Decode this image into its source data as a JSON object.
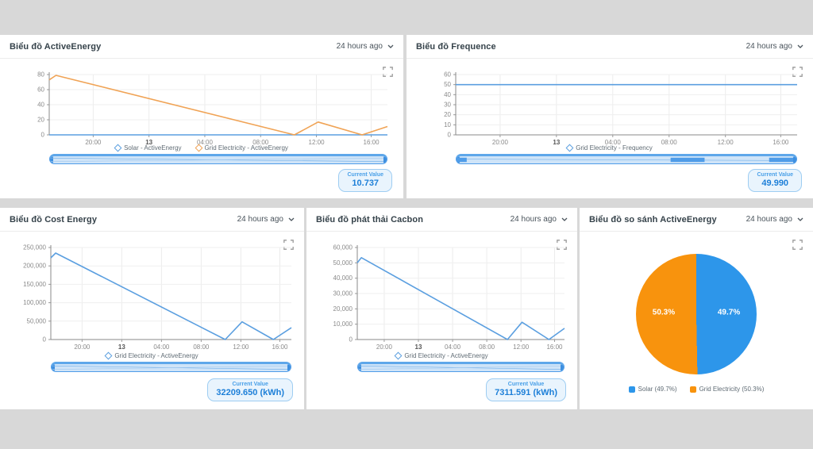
{
  "page": {
    "background": "#d8d8d8"
  },
  "icons": {
    "fullscreen": "fullscreen-icon",
    "chevron": "chevron-down-icon"
  },
  "colors": {
    "pie_blue": "#2d96ea",
    "pie_orange": "#f8930d",
    "line_blue": "#5b9fe0",
    "line_orange": "#f0a355",
    "value_text": "#1d7fd8"
  },
  "panels": [
    {
      "title": "Biểu đồ ActiveEnergy",
      "time_range": "24 hours ago",
      "current_value_label": "Current Value",
      "current_value": "10.737"
    },
    {
      "title": "Biểu đồ Frequence",
      "time_range": "24 hours ago",
      "current_value_label": "Current Value",
      "current_value": "49.990"
    },
    {
      "title": "Biểu đồ Cost Energy",
      "time_range": "24 hours ago",
      "current_value_label": "Current Value",
      "current_value": "32209.650 (kWh)"
    },
    {
      "title": "Biểu đồ phát thải Cacbon",
      "time_range": "24 hours ago",
      "current_value_label": "Current Value",
      "current_value": "7311.591 (kWh)"
    },
    {
      "title": "Biểu đồ so sánh ActiveEnergy",
      "time_range": "24 hours ago"
    }
  ],
  "chart_data": [
    {
      "type": "line",
      "title": "Biểu đồ ActiveEnergy",
      "xlabel": "",
      "ylabel": "",
      "ylim": [
        0,
        80
      ],
      "y_ticks": [
        "0",
        "20",
        "40",
        "60",
        "80"
      ],
      "grid": true,
      "legend_position": "bottom",
      "x_ticks": [
        {
          "label": "20:00",
          "x": 0.13
        },
        {
          "label": "13",
          "x": 0.295,
          "bold": true
        },
        {
          "label": "04:00",
          "x": 0.46
        },
        {
          "label": "08:00",
          "x": 0.625
        },
        {
          "label": "12:00",
          "x": 0.79
        },
        {
          "label": "16:00",
          "x": 0.952
        }
      ],
      "margins": {
        "l": 62,
        "r": 20
      },
      "series": [
        {
          "name": "Solar - ActiveEnergy",
          "color": "#5b9fe0",
          "points": [
            [
              0,
              0
            ],
            [
              1,
              0
            ]
          ]
        },
        {
          "name": "Grid Electricity - ActiveEnergy",
          "color": "#f0a355",
          "points": [
            [
              0,
              73
            ],
            [
              0.02,
              79
            ],
            [
              0.725,
              0
            ],
            [
              0.795,
              17
            ],
            [
              0.925,
              0
            ],
            [
              1,
              11
            ]
          ]
        }
      ]
    },
    {
      "type": "line",
      "title": "Biểu đồ Frequence",
      "xlabel": "",
      "ylabel": "",
      "ylim": [
        0,
        60
      ],
      "y_ticks": [
        "0",
        "10",
        "20",
        "30",
        "40",
        "50",
        "60"
      ],
      "grid": true,
      "legend_position": "bottom",
      "x_ticks": [
        {
          "label": "20:00",
          "x": 0.13
        },
        {
          "label": "13",
          "x": 0.295,
          "bold": true
        },
        {
          "label": "04:00",
          "x": 0.46
        },
        {
          "label": "08:00",
          "x": 0.625
        },
        {
          "label": "12:00",
          "x": 0.79
        },
        {
          "label": "16:00",
          "x": 0.952
        }
      ],
      "margins": {
        "l": 62,
        "r": 20
      },
      "series": [
        {
          "name": "Grid Electricity - Frequency",
          "color": "#5b9fe0",
          "points": [
            [
              0,
              50
            ],
            [
              1,
              50
            ]
          ]
        }
      ]
    },
    {
      "type": "line",
      "title": "Biểu đồ Cost Energy",
      "xlabel": "",
      "ylabel": "",
      "ylim": [
        0,
        250000
      ],
      "y_ticks": [
        "0",
        "50,000",
        "100,000",
        "150,000",
        "200,000",
        "250,000"
      ],
      "grid": true,
      "legend_position": "bottom",
      "x_ticks": [
        {
          "label": "20:00",
          "x": 0.13
        },
        {
          "label": "13",
          "x": 0.295,
          "bold": true
        },
        {
          "label": "04:00",
          "x": 0.46
        },
        {
          "label": "08:00",
          "x": 0.625
        },
        {
          "label": "12:00",
          "x": 0.79
        },
        {
          "label": "16:00",
          "x": 0.952
        }
      ],
      "margins": {
        "l": 64,
        "r": 16
      },
      "series": [
        {
          "name": "Grid Electricity - ActiveEnergy",
          "color": "#5b9fe0",
          "points": [
            [
              0,
              222000
            ],
            [
              0.02,
              235000
            ],
            [
              0.725,
              0
            ],
            [
              0.795,
              48000
            ],
            [
              0.925,
              0
            ],
            [
              1,
              32210
            ]
          ]
        }
      ]
    },
    {
      "type": "line",
      "title": "Biểu đồ phát thải Cacbon",
      "xlabel": "",
      "ylabel": "",
      "ylim": [
        0,
        60000
      ],
      "y_ticks": [
        "0",
        "10,000",
        "20,000",
        "30,000",
        "40,000",
        "50,000",
        "60,000"
      ],
      "grid": true,
      "legend_position": "bottom",
      "x_ticks": [
        {
          "label": "20:00",
          "x": 0.13
        },
        {
          "label": "13",
          "x": 0.295,
          "bold": true
        },
        {
          "label": "04:00",
          "x": 0.46
        },
        {
          "label": "08:00",
          "x": 0.625
        },
        {
          "label": "12:00",
          "x": 0.79
        },
        {
          "label": "16:00",
          "x": 0.952
        }
      ],
      "margins": {
        "l": 64,
        "r": 16
      },
      "series": [
        {
          "name": "Grid Electricity - ActiveEnergy",
          "color": "#5b9fe0",
          "points": [
            [
              0,
              50000
            ],
            [
              0.02,
              53400
            ],
            [
              0.725,
              0
            ],
            [
              0.795,
              11300
            ],
            [
              0.925,
              0
            ],
            [
              1,
              7312
            ]
          ]
        }
      ]
    },
    {
      "type": "pie",
      "title": "Biểu đồ so sánh ActiveEnergy",
      "legend_position": "bottom",
      "slices": [
        {
          "name": "Solar",
          "value": 49.7,
          "color": "#2d96ea",
          "label": "49.7%"
        },
        {
          "name": "Grid Electricity",
          "value": 50.3,
          "color": "#f8930d",
          "label": "50.3%"
        }
      ],
      "legend": [
        "Solar (49.7%)",
        "Grid Electricity (50.3%)"
      ]
    }
  ]
}
